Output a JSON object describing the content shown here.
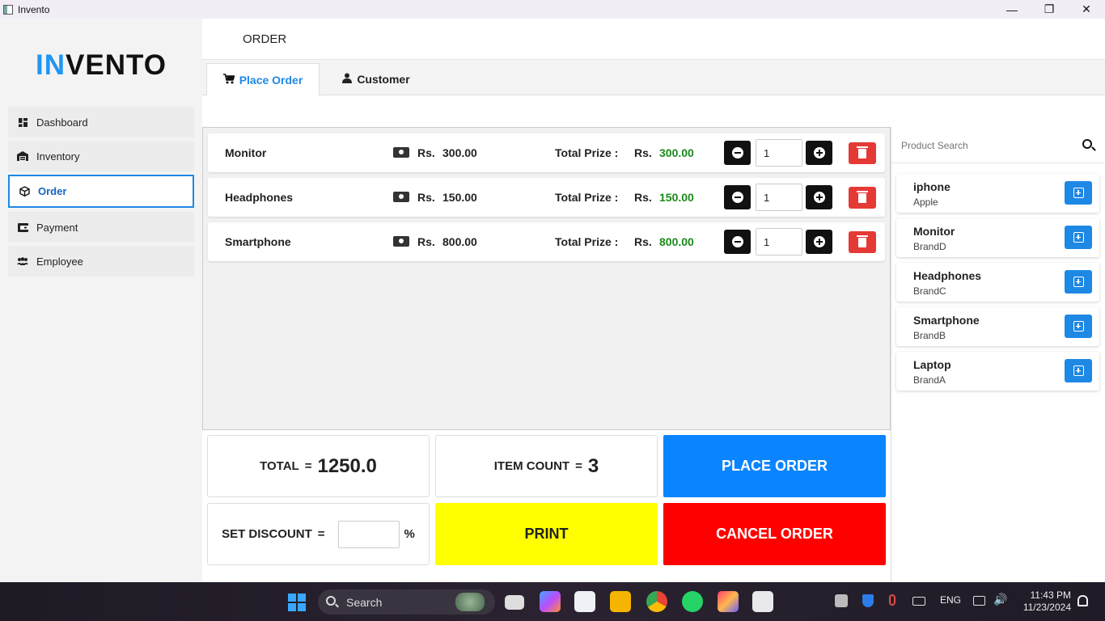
{
  "window": {
    "title": "Invento",
    "controls": [
      "minimize",
      "restore",
      "close"
    ]
  },
  "sidebar": {
    "logo_accent": "IN",
    "logo_rest": "VENTO",
    "items": [
      {
        "label": "Dashboard",
        "icon": "dashboard-icon"
      },
      {
        "label": "Inventory",
        "icon": "warehouse-icon"
      },
      {
        "label": "Order",
        "icon": "box-icon",
        "active": true
      },
      {
        "label": "Payment",
        "icon": "payment-icon"
      },
      {
        "label": "Employee",
        "icon": "users-icon"
      }
    ]
  },
  "header": {
    "title": "ORDER"
  },
  "tabs": [
    {
      "label": "Place Order",
      "icon": "cart-icon",
      "active": true
    },
    {
      "label": "Customer",
      "icon": "user-icon",
      "active": false
    }
  ],
  "order_items": [
    {
      "name": "Monitor",
      "currency": "Rs.",
      "price": "300.00",
      "total_label": "Total Prize :",
      "total_currency": "Rs.",
      "total": "300.00",
      "qty": "1"
    },
    {
      "name": "Headphones",
      "currency": "Rs.",
      "price": "150.00",
      "total_label": "Total Prize :",
      "total_currency": "Rs.",
      "total": "150.00",
      "qty": "1"
    },
    {
      "name": "Smartphone",
      "currency": "Rs.",
      "price": "800.00",
      "total_label": "Total Prize :",
      "total_currency": "Rs.",
      "total": "800.00",
      "qty": "1"
    }
  ],
  "summary": {
    "total_label": "TOTAL",
    "eq": "=",
    "total_value": "1250.0",
    "count_label": "ITEM COUNT",
    "count_value": "3",
    "discount_label": "SET DISCOUNT",
    "discount_value": "",
    "percent": "%"
  },
  "buttons": {
    "place": "PLACE ORDER",
    "print": "PRINT",
    "cancel": "CANCEL ORDER"
  },
  "product_search": {
    "placeholder": "Product Search"
  },
  "products": [
    {
      "name": "iphone",
      "brand": "Apple"
    },
    {
      "name": "Monitor",
      "brand": "BrandD"
    },
    {
      "name": "Headphones",
      "brand": "BrandC"
    },
    {
      "name": "Smartphone",
      "brand": "BrandB"
    },
    {
      "name": "Laptop",
      "brand": "BrandA"
    }
  ],
  "taskbar": {
    "search": "Search",
    "lang": "ENG",
    "time": "11:43 PM",
    "date": "11/23/2024"
  },
  "colors": {
    "accent": "#1e88e5",
    "place": "#0a84ff",
    "print": "#ffff00",
    "cancel": "#ff0000",
    "total_green": "#1a8a1a",
    "delete": "#e53935"
  }
}
